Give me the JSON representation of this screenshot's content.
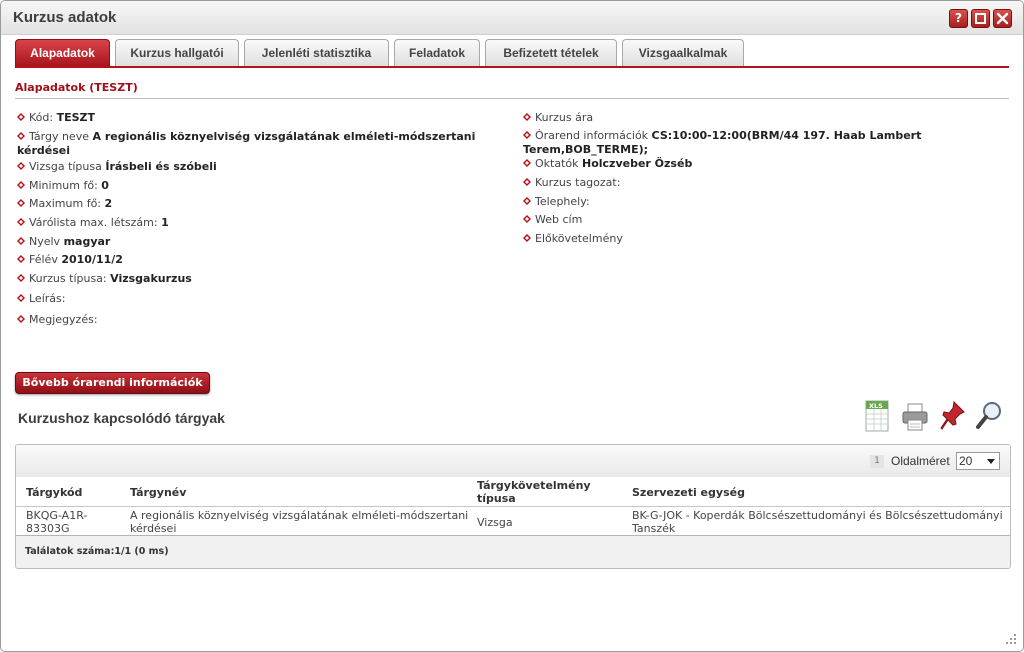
{
  "window": {
    "title": "Kurzus adatok",
    "help_label": "?",
    "maximize_label": "□",
    "close_label": "✕"
  },
  "tabs": [
    {
      "label": "Alapadatok",
      "active": true
    },
    {
      "label": "Kurzus hallgatói",
      "active": false
    },
    {
      "label": "Jelenléti statisztika",
      "active": false
    },
    {
      "label": "Feladatok",
      "active": false
    },
    {
      "label": "Befizetett tételek",
      "active": false
    },
    {
      "label": "Vizsgaalkalmak",
      "active": false
    }
  ],
  "section": {
    "title": "Alapadatok (TESZT)"
  },
  "left_fields": [
    {
      "label": "Kód:",
      "value": "TESZT"
    },
    {
      "label": "Tárgy neve",
      "value": "A regionális köznyelviség vizsgálatának elméleti-módszertani",
      "value2": "kérdései"
    },
    {
      "label": "Vizsga típusa",
      "value": "Írásbeli és szóbeli"
    },
    {
      "label": "Minimum fő:",
      "value": "0"
    },
    {
      "label": "Maximum fő:",
      "value": "2"
    },
    {
      "label": "Várólista max. létszám:",
      "value": "1"
    },
    {
      "label": "Nyelv",
      "value": "magyar"
    },
    {
      "label": "Félév",
      "value": "2010/11/2"
    },
    {
      "label": "Kurzus típusa:",
      "value": "Vizsgakurzus"
    },
    {
      "label": "Leírás:",
      "value": ""
    },
    {
      "label": "Megjegyzés:",
      "value": ""
    }
  ],
  "right_fields": [
    {
      "label": "Kurzus ára",
      "value": ""
    },
    {
      "label": "Órarend információk",
      "value": "CS:10:00-12:00(BRM/44 197. Haab Lambert",
      "value2": "Terem,BOB_TERME);"
    },
    {
      "label": "Oktatók",
      "value": "Holczveber Özséb"
    },
    {
      "label": "Kurzus tagozat:",
      "value": ""
    },
    {
      "label": "Telephely:",
      "value": ""
    },
    {
      "label": "Web cím",
      "value": ""
    },
    {
      "label": "Előkövetelmény",
      "value": ""
    }
  ],
  "more_button": {
    "label": "Bővebb órarendi információk"
  },
  "subjects": {
    "title": "Kurzushoz kapcsolódó tárgyak",
    "tools": [
      "excel-export-icon",
      "print-icon",
      "pin-icon",
      "search-icon"
    ],
    "excel_label": "XLS",
    "pager": {
      "page": "1",
      "size_label": "Oldalméret",
      "size_value": "20"
    },
    "columns": [
      "Tárgykód",
      "Tárgynév",
      "Tárgykövetelmény típusa",
      "Szervezeti egység"
    ],
    "columns_split": {
      "req_line1": "Tárgykövetelmény",
      "req_line2": "típusa"
    },
    "rows": [
      {
        "code_line1": "BKQG-A1R-",
        "code_line2": "83303G",
        "name_line1": "A regionális köznyelviség vizsgálatának elméleti-módszertani",
        "name_line2": "kérdései",
        "req": "Vizsga",
        "org_line1": "BK-G-JOK - Koperdák Bölcsészettudományi és Bölcsészettudományi",
        "org_line2": "Tanszék"
      }
    ],
    "footer": "Találatok száma:1/1 (0 ms)"
  },
  "colors": {
    "accent": "#b5121b",
    "tab_inactive": "#e6e6e6"
  }
}
